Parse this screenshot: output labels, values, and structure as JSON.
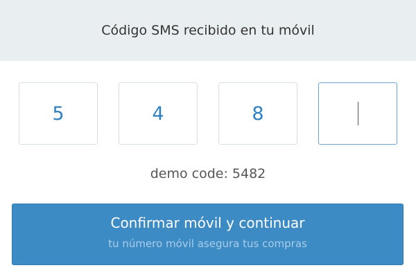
{
  "header": {
    "title": "Código SMS recibido en tu móvil"
  },
  "code_inputs": [
    "5",
    "4",
    "8",
    ""
  ],
  "demo_text": "demo code: 5482",
  "confirm_button": {
    "label": "Confirmar móvil y continuar",
    "sublabel": "tu número móvil asegura tus compras"
  },
  "colors": {
    "accent": "#3d8bc4",
    "header_bg": "#e9eef1",
    "digit": "#2f80c0"
  }
}
